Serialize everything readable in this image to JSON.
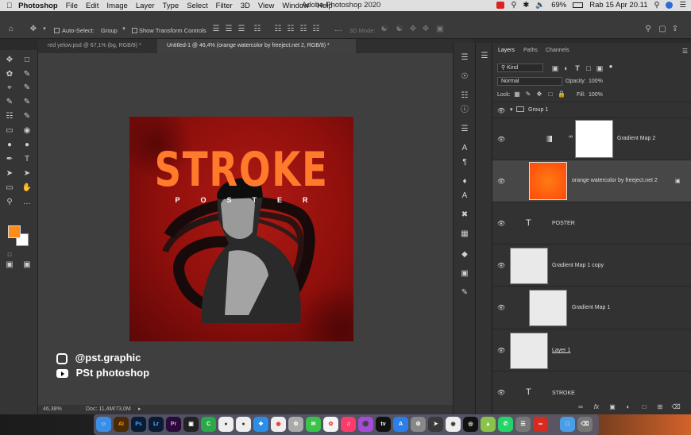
{
  "menubar": {
    "app_name": "Photoshop",
    "items": [
      "File",
      "Edit",
      "Image",
      "Layer",
      "Type",
      "Select",
      "Filter",
      "3D",
      "View",
      "Window",
      "Help"
    ],
    "window_title": "Adobe Photoshop 2020",
    "battery": "69%",
    "datetime": "Rab 15 Apr  20.11"
  },
  "options_bar": {
    "auto_select_label": "Auto-Select:",
    "auto_select_value": "Group",
    "show_transform_label": "Show Transform Controls",
    "mode_3d_label": "3D Mode:"
  },
  "tabs": [
    {
      "label": "red yelow.psd @ 67,1% (bg, RGB/8) *",
      "active": false
    },
    {
      "label": "Untitled-1 @ 46,4% (orange watercolor by freeject.net 2, RGB/8) *",
      "active": true
    }
  ],
  "artwork": {
    "title": "STROKE",
    "subtitle": "POSTER"
  },
  "watermark": {
    "instagram": "@pst.graphic",
    "youtube": "PSt photoshop"
  },
  "status": {
    "zoom": "46,38%",
    "doc": "Doc: 11,4M/73,0M"
  },
  "layers_panel": {
    "tabs": [
      "Layers",
      "Paths",
      "Channels"
    ],
    "filter_kind": "Kind",
    "blend_mode": "Normal",
    "opacity_label": "Opacity:",
    "opacity_value": "100%",
    "lock_label": "Lock:",
    "fill_label": "Fill:",
    "fill_value": "100%",
    "layers": [
      {
        "name": "Group 1",
        "type": "group"
      },
      {
        "name": "Gradient Map 2",
        "type": "adjustment"
      },
      {
        "name": "orange watercolor by freeject.net 2",
        "type": "image",
        "selected": true
      },
      {
        "name": "POSTER",
        "type": "text"
      },
      {
        "name": "Gradient Map 1 copy",
        "type": "adjustment"
      },
      {
        "name": "Gradient Map 1",
        "type": "adjustment"
      },
      {
        "name": "Layer 1",
        "type": "image"
      },
      {
        "name": "STROKE",
        "type": "text"
      }
    ]
  },
  "colors": {
    "foreground": "#ff8c1a",
    "background": "#ffffff",
    "accent": "#2d6bd6"
  }
}
